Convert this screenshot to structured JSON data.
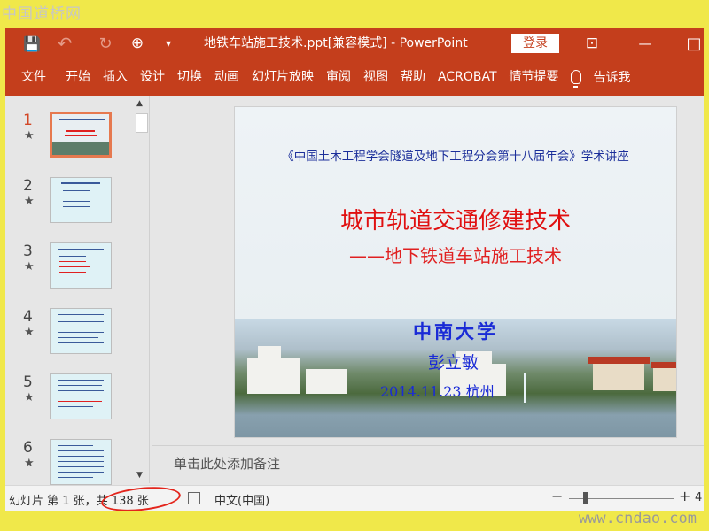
{
  "watermarks": {
    "top": "中国道桥网",
    "bottom": "www.cndao.com"
  },
  "titlebar": {
    "doc_title": "地铁车站施工技术.ppt[兼容模式]  -  PowerPoint",
    "login": "登录",
    "icons": {
      "save": "💾",
      "undo": "↶",
      "redo": "↻",
      "present": "⊕",
      "customize": "▾",
      "ribbon_options": "⊡",
      "minimize": "—",
      "maximize": "□"
    }
  },
  "ribbon": {
    "tabs": [
      "文件",
      "开始",
      "插入",
      "设计",
      "切换",
      "动画",
      "幻灯片放映",
      "审阅",
      "视图",
      "帮助",
      "ACROBAT",
      "情节提要"
    ],
    "tell_me": "告诉我"
  },
  "thumbnails": [
    {
      "number": "1",
      "star": "★",
      "active": true
    },
    {
      "number": "2",
      "star": "★",
      "active": false
    },
    {
      "number": "3",
      "star": "★",
      "active": false
    },
    {
      "number": "4",
      "star": "★",
      "active": false
    },
    {
      "number": "5",
      "star": "★",
      "active": false
    },
    {
      "number": "6",
      "star": "★",
      "active": false
    }
  ],
  "scrollbar": {
    "up": "▲",
    "down": "▼"
  },
  "slide": {
    "conference": "《中国土木工程学会隧道及地下工程分会第十八届年会》学术讲座",
    "title": "城市轨道交通修建技术",
    "subtitle": "——地下铁道车站施工技术",
    "university": "中南大学",
    "author": "彭立敏",
    "date": "2014.11.23  杭州"
  },
  "notes_placeholder": "单击此处添加备注",
  "status": {
    "slide_position": "幻灯片 第 1 张，共 138 张",
    "language": "中文(中国)",
    "zoom_minus": "−",
    "zoom_plus": "+",
    "zoom_value": "4"
  },
  "colors": {
    "accent": "#c43e1c",
    "annotation_oval": "#e3251c",
    "slide_title": "#e01010",
    "slide_blue": "#1a2bd6"
  }
}
